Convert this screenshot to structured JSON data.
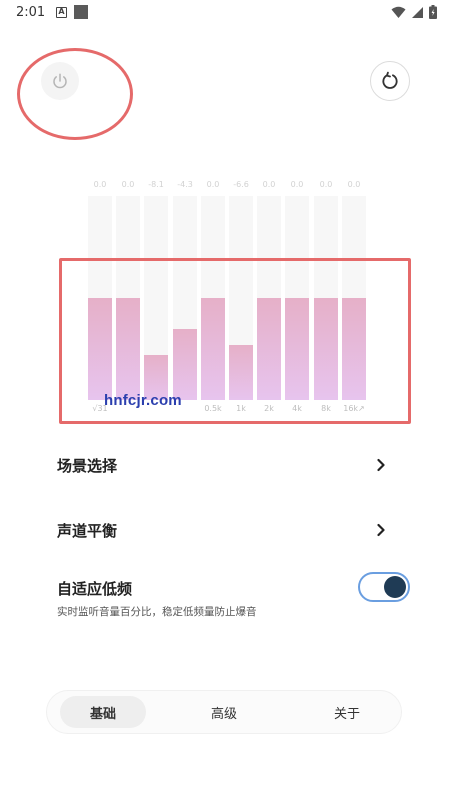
{
  "status_bar": {
    "time": "2:01",
    "left_icons": [
      "notification-a-icon",
      "image-placeholder-icon"
    ],
    "right_icons": [
      "wifi-icon",
      "signal-icon",
      "battery-icon"
    ]
  },
  "header": {
    "power_icon": "power-icon",
    "reset_icon": "reset-icon"
  },
  "equalizer": {
    "values": [
      "0.0",
      "0.0",
      "-8.1",
      "-4.3",
      "0.0",
      "-6.6",
      "0.0",
      "0.0",
      "0.0",
      "0.0"
    ],
    "levels": [
      0.5,
      0.5,
      0.22,
      0.35,
      0.5,
      0.27,
      0.5,
      0.5,
      0.5,
      0.5
    ],
    "frequencies": [
      "√31",
      "",
      "",
      "",
      "0.5k",
      "1k",
      "2k",
      "4k",
      "8k",
      "16k↗"
    ],
    "bar_color_top": "#e6b0c8",
    "bar_color_bottom": "#e7c4ee"
  },
  "watermark": "hnfcjr.com",
  "settings": {
    "scene": {
      "label": "场景选择"
    },
    "balance": {
      "label": "声道平衡"
    },
    "adaptive_bass": {
      "label": "自适应低频",
      "description": "实时监听音量百分比，稳定低频量防止爆音",
      "enabled": true
    }
  },
  "tabs": [
    {
      "label": "基础",
      "active": true
    },
    {
      "label": "高级",
      "active": false
    },
    {
      "label": "关于",
      "active": false
    }
  ],
  "colors": {
    "highlight": "#e56a6a",
    "toggle_border": "#6a9ee0",
    "toggle_knob": "#1f3b55",
    "watermark": "#2b3fae"
  }
}
